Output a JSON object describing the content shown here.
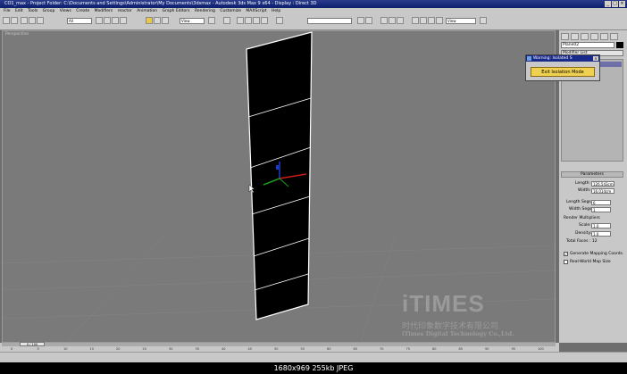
{
  "title_bar": {
    "title": "CO1_max  - Project Folder: C:\\Documents and Settings\\Administrator\\My Documents\\3dsmax  - Autodesk 3ds Max 9 x64  - Display : Direct 3D"
  },
  "menu_bar": {
    "items": [
      "File",
      "Edit",
      "Tools",
      "Group",
      "Views",
      "Create",
      "Modifiers",
      "reactor",
      "Animation",
      "Graph Editors",
      "Rendering",
      "Customize",
      "MAXScript",
      "Help"
    ]
  },
  "toolbar": {
    "selection_filter": "All",
    "ref_coord": "View",
    "ref_coord_2": "View"
  },
  "viewport": {
    "label": "Perspective"
  },
  "command_panel": {
    "object_name": "Plane02",
    "modifier_list": "Modifier List",
    "parameters_title": "Parameters",
    "length_label": "Length:",
    "length_value": "126.543cm",
    "width_label": "Width:",
    "width_value": "16.014cm",
    "length_segs_label": "Length Segs:",
    "length_segs_value": "6",
    "width_segs_label": "Width Segs:",
    "width_segs_value": "1",
    "render_mult_label": "Render Multipliers",
    "scale_label": "Scale:",
    "scale_value": "1.0",
    "density_label": "Density:",
    "density_value": "1.0",
    "total_faces": "Total Faces : 12",
    "gen_mapping": "Generate Mapping Coords.",
    "real_world": "Real-World Map Size"
  },
  "warning_dialog": {
    "title": "Warning: Isolated S",
    "button": "Exit Isolation Mode"
  },
  "timeline": {
    "frame": "0 / 100",
    "ticks": [
      "0",
      "5",
      "10",
      "15",
      "20",
      "25",
      "30",
      "35",
      "40",
      "45",
      "50",
      "55",
      "60",
      "65",
      "70",
      "75",
      "80",
      "85",
      "90",
      "95",
      "100"
    ]
  },
  "watermark": {
    "brand": "iTIMES",
    "chinese": "时代印象数字技术有限公司",
    "english": "iTimes Digital Technology Co.,Ltd."
  },
  "caption": "1680x969  255kb  JPEG"
}
